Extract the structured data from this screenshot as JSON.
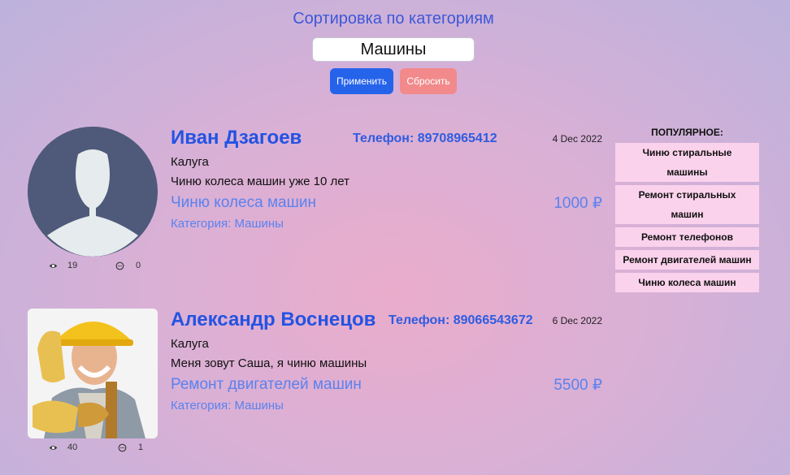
{
  "filter": {
    "title": "Сортировка по категориям",
    "value": "Машины",
    "apply_label": "Применить",
    "reset_label": "Сбросить"
  },
  "listings": [
    {
      "name": "Иван Дзагоев",
      "phone": "Телефон: 89708965412",
      "date": "4 Dec 2022",
      "city": "Калуга",
      "description": "Чиню колеса машин уже 10 лет",
      "service": "Чиню колеса машин",
      "price": "1000 ₽",
      "category": "Категория: Машины",
      "views": "19",
      "comments": "0"
    },
    {
      "name": "Александр Воснецов",
      "phone": "Телефон: 89066543672",
      "date": "6 Dec 2022",
      "city": "Калуга",
      "description": "Меня зовут Саша, я чиню машины",
      "service": "Ремонт двигателей машин",
      "price": "5500 ₽",
      "category": "Категория: Машины",
      "views": "40",
      "comments": "1"
    }
  ],
  "popular": {
    "title": "ПОПУЛЯРНОЕ:",
    "items": [
      "Чиню стиральные машины",
      "Ремонт стиральных машин",
      "Ремонт телефонов",
      "Ремонт двигателей машин",
      "Чиню колеса машин"
    ]
  },
  "colors": {
    "accent": "#2353e2",
    "apply": "#2563eb",
    "reset": "#f28a8c",
    "popular_item_bg": "#fbd2ec"
  }
}
